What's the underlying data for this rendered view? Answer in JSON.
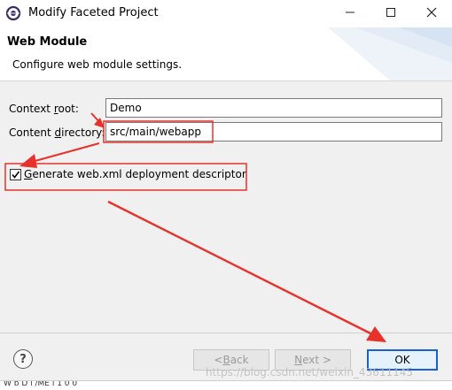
{
  "window": {
    "title": "Modify Faceted Project"
  },
  "header": {
    "title": "Web Module",
    "description": "Configure web module settings."
  },
  "form": {
    "context_root": {
      "label_pre": "Context ",
      "label_key": "r",
      "label_post": "oot:",
      "value": "Demo"
    },
    "content_directory": {
      "label_pre": "Content ",
      "label_key": "d",
      "label_post": "irectory:",
      "value": "src/main/webapp"
    },
    "generate_descriptor": {
      "label_key": "G",
      "label_post": "enerate web.xml deployment descriptor",
      "checked": true
    }
  },
  "footer": {
    "back": {
      "pre": "< ",
      "key": "B",
      "post": "ack"
    },
    "next": {
      "pre": "",
      "key": "N",
      "post": "ext >"
    },
    "ok": "OK"
  },
  "bottom": {
    "text": "W b D  l  /ME    i               1 0 0"
  },
  "watermark": "https://blog.csdn.net/weixin_43611145",
  "colors": {
    "annotation": "#e8312a",
    "ok_border": "#1a5fd4"
  }
}
